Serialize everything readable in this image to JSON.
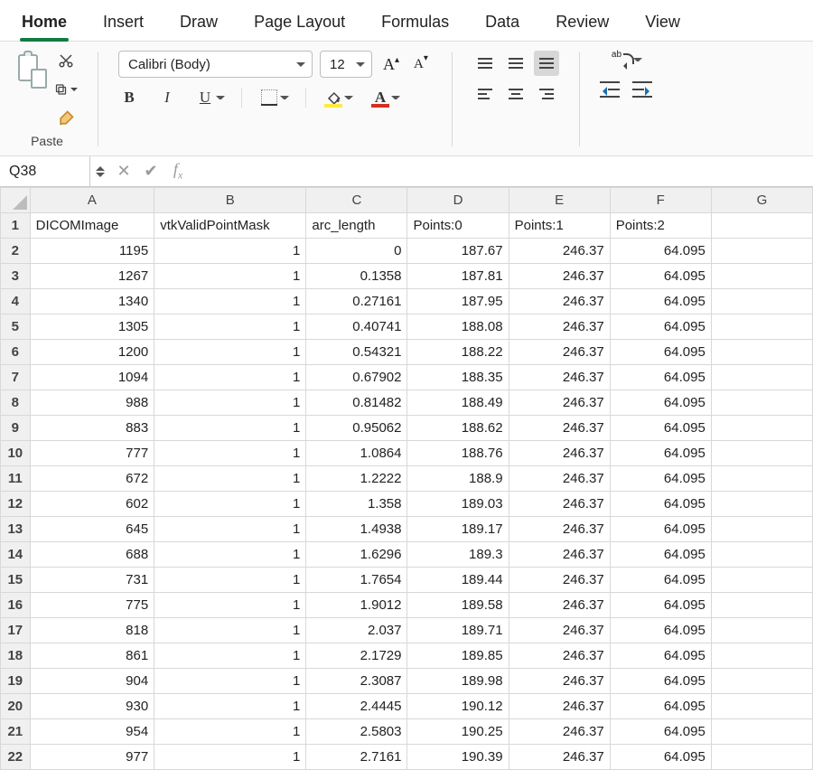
{
  "ribbon": {
    "tabs": [
      "Home",
      "Insert",
      "Draw",
      "Page Layout",
      "Formulas",
      "Data",
      "Review",
      "View"
    ],
    "active": "Home"
  },
  "toolbar": {
    "paste_label": "Paste",
    "font_name": "Calibri (Body)",
    "font_size": "12",
    "bold": "B",
    "italic": "I",
    "underline": "U",
    "grow_font": "A",
    "shrink_font": "A",
    "font_color_letter": "A"
  },
  "formula_bar": {
    "name_box": "Q38",
    "fx_label": "f",
    "fx_sub": "x",
    "formula": ""
  },
  "sheet": {
    "column_letters": [
      "A",
      "B",
      "C",
      "D",
      "E",
      "F",
      "G"
    ],
    "column_classes": [
      "colA",
      "colB",
      "colC",
      "colD",
      "colE",
      "colF",
      "colG"
    ],
    "headers": [
      "DICOMImage",
      "vtkValidPointMask",
      "arc_length",
      "Points:0",
      "Points:1",
      "Points:2",
      ""
    ],
    "rows": [
      {
        "n": 2,
        "cells": [
          "1195",
          "1",
          "0",
          "187.67",
          "246.37",
          "64.095",
          ""
        ]
      },
      {
        "n": 3,
        "cells": [
          "1267",
          "1",
          "0.1358",
          "187.81",
          "246.37",
          "64.095",
          ""
        ]
      },
      {
        "n": 4,
        "cells": [
          "1340",
          "1",
          "0.27161",
          "187.95",
          "246.37",
          "64.095",
          ""
        ]
      },
      {
        "n": 5,
        "cells": [
          "1305",
          "1",
          "0.40741",
          "188.08",
          "246.37",
          "64.095",
          ""
        ]
      },
      {
        "n": 6,
        "cells": [
          "1200",
          "1",
          "0.54321",
          "188.22",
          "246.37",
          "64.095",
          ""
        ]
      },
      {
        "n": 7,
        "cells": [
          "1094",
          "1",
          "0.67902",
          "188.35",
          "246.37",
          "64.095",
          ""
        ]
      },
      {
        "n": 8,
        "cells": [
          "988",
          "1",
          "0.81482",
          "188.49",
          "246.37",
          "64.095",
          ""
        ]
      },
      {
        "n": 9,
        "cells": [
          "883",
          "1",
          "0.95062",
          "188.62",
          "246.37",
          "64.095",
          ""
        ]
      },
      {
        "n": 10,
        "cells": [
          "777",
          "1",
          "1.0864",
          "188.76",
          "246.37",
          "64.095",
          ""
        ]
      },
      {
        "n": 11,
        "cells": [
          "672",
          "1",
          "1.2222",
          "188.9",
          "246.37",
          "64.095",
          ""
        ]
      },
      {
        "n": 12,
        "cells": [
          "602",
          "1",
          "1.358",
          "189.03",
          "246.37",
          "64.095",
          ""
        ]
      },
      {
        "n": 13,
        "cells": [
          "645",
          "1",
          "1.4938",
          "189.17",
          "246.37",
          "64.095",
          ""
        ]
      },
      {
        "n": 14,
        "cells": [
          "688",
          "1",
          "1.6296",
          "189.3",
          "246.37",
          "64.095",
          ""
        ]
      },
      {
        "n": 15,
        "cells": [
          "731",
          "1",
          "1.7654",
          "189.44",
          "246.37",
          "64.095",
          ""
        ]
      },
      {
        "n": 16,
        "cells": [
          "775",
          "1",
          "1.9012",
          "189.58",
          "246.37",
          "64.095",
          ""
        ]
      },
      {
        "n": 17,
        "cells": [
          "818",
          "1",
          "2.037",
          "189.71",
          "246.37",
          "64.095",
          ""
        ]
      },
      {
        "n": 18,
        "cells": [
          "861",
          "1",
          "2.1729",
          "189.85",
          "246.37",
          "64.095",
          ""
        ]
      },
      {
        "n": 19,
        "cells": [
          "904",
          "1",
          "2.3087",
          "189.98",
          "246.37",
          "64.095",
          ""
        ]
      },
      {
        "n": 20,
        "cells": [
          "930",
          "1",
          "2.4445",
          "190.12",
          "246.37",
          "64.095",
          ""
        ]
      },
      {
        "n": 21,
        "cells": [
          "954",
          "1",
          "2.5803",
          "190.25",
          "246.37",
          "64.095",
          ""
        ]
      },
      {
        "n": 22,
        "cells": [
          "977",
          "1",
          "2.7161",
          "190.39",
          "246.37",
          "64.095",
          ""
        ]
      }
    ]
  }
}
